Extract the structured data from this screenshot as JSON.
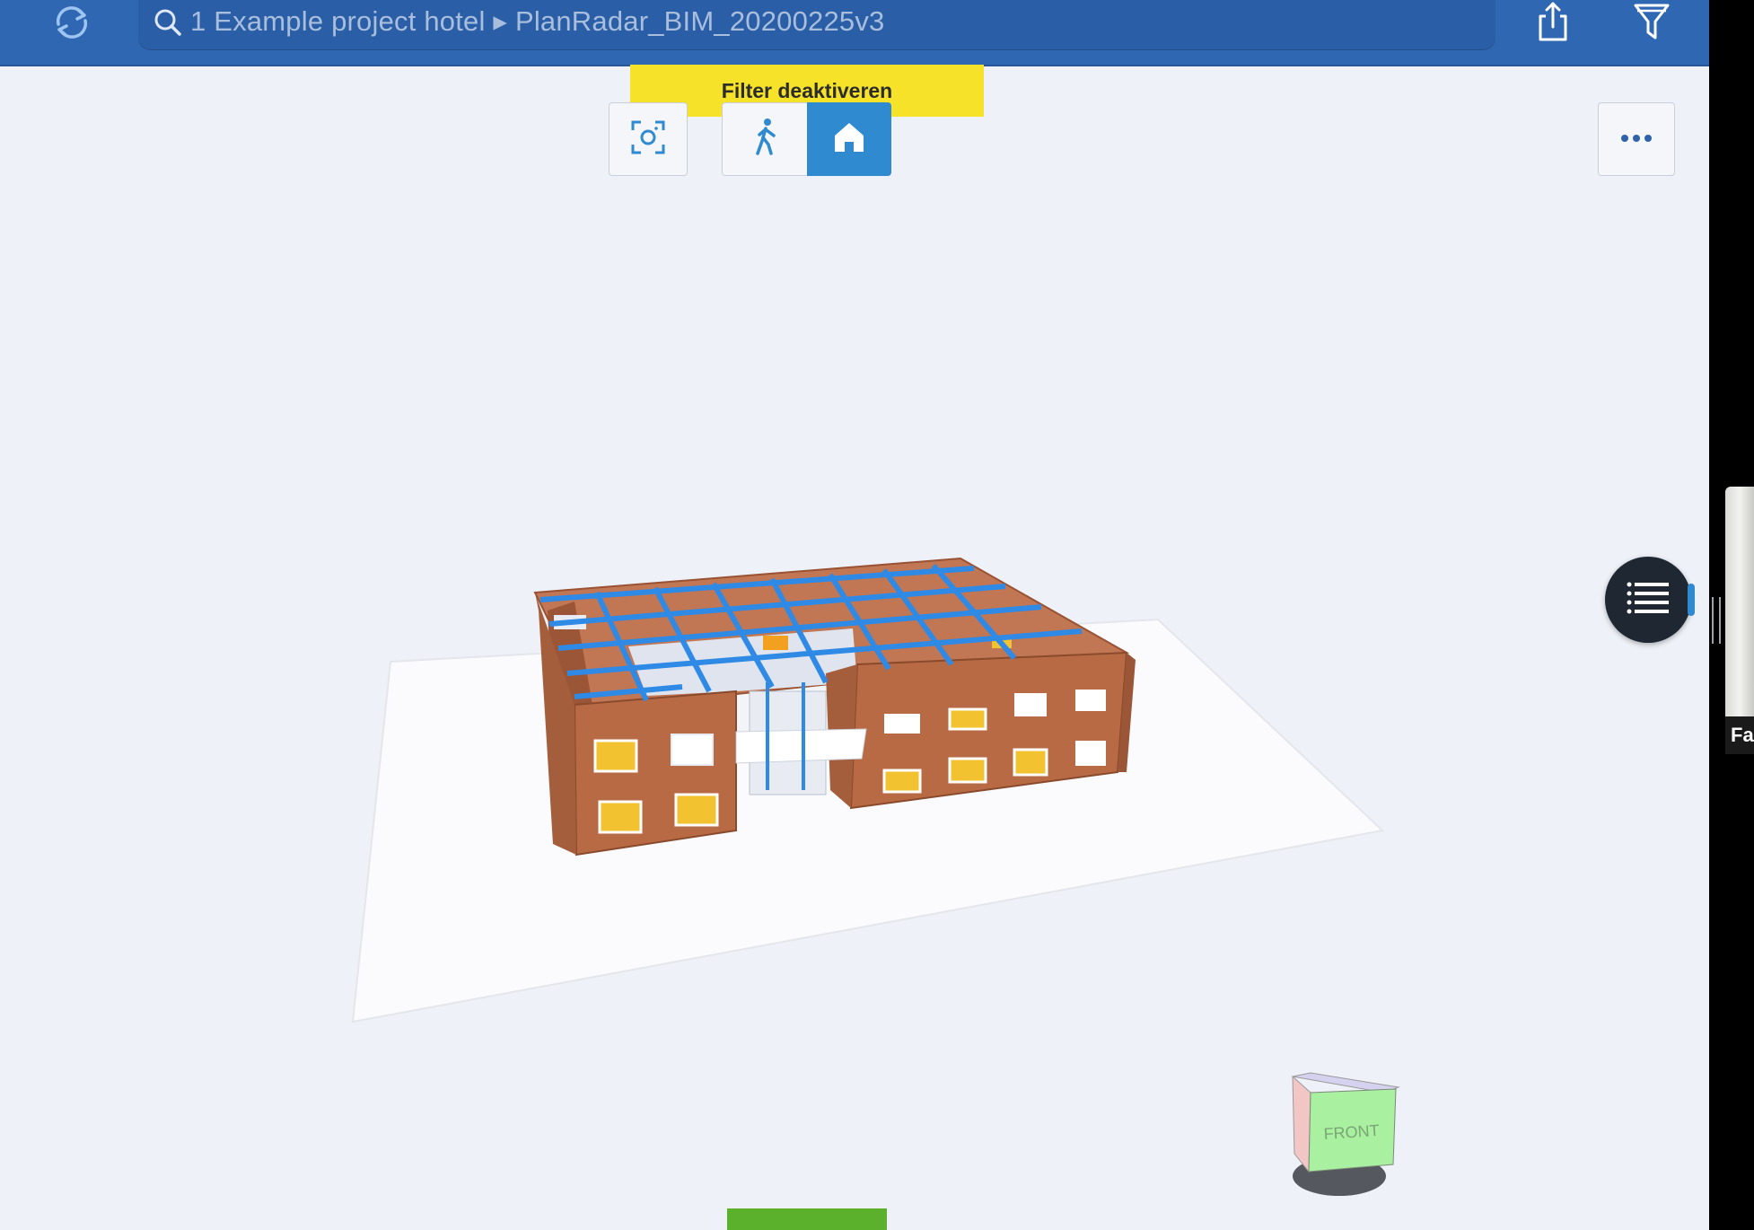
{
  "topbar": {
    "search_text": "1 Example project hotel ▸ PlanRadar_BIM_20200225v3",
    "refresh_icon": "refresh-icon",
    "search_icon": "search-icon",
    "share_icon": "share-icon",
    "filter_icon": "filter-icon"
  },
  "banner": {
    "label": "Filter deaktiveren"
  },
  "toolbar": {
    "screenshot_icon": "camera-focus-icon",
    "walk_icon": "walking-person-icon",
    "home_icon": "home-icon",
    "more_icon": "ellipsis-icon",
    "active_mode": "home"
  },
  "viewcube": {
    "face_label": "FRONT"
  },
  "side_panel": {
    "participant_label": "Fa"
  },
  "colors": {
    "topbar": "#2f67b2",
    "banner": "#f5e229",
    "active_button": "#2f8ad0",
    "fab": "#1f2733",
    "brick": "#b86a44",
    "beam": "#2f8ae6",
    "viewcube_front": "#a9f0a0",
    "green_tab": "#5bb02c"
  }
}
